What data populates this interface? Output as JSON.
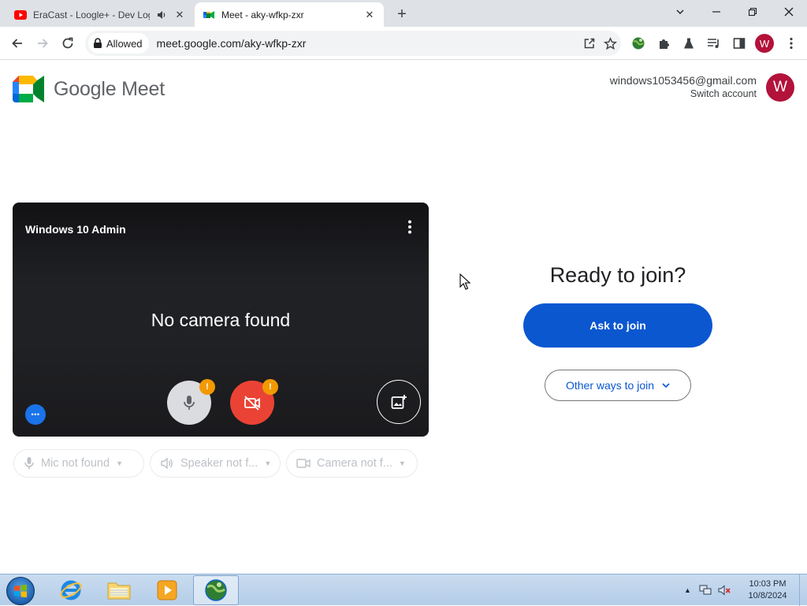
{
  "browser": {
    "tabs": [
      {
        "title": "EraCast - Loogle+ - Dev Log",
        "active": false
      },
      {
        "title": "Meet - aky-wfkp-zxr",
        "active": true
      }
    ],
    "new_tab_label": "+",
    "site_chip": "Allowed",
    "url": "meet.google.com/aky-wfkp-zxr",
    "profile_initial": "W"
  },
  "meet": {
    "brand": "Google Meet",
    "account_email": "windows1053456@gmail.com",
    "switch_account": "Switch account",
    "avatar_initial": "W",
    "participant_name": "Windows 10 Admin",
    "no_camera_text": "No camera found",
    "warn_glyph": "!",
    "more_dots": "•••",
    "devices": {
      "mic": "Mic not found",
      "speaker": "Speaker not f...",
      "camera": "Camera not f..."
    },
    "ready_heading": "Ready to join?",
    "ask_to_join": "Ask to join",
    "other_ways": "Other ways to join"
  },
  "taskbar": {
    "time": "10:03 PM",
    "date": "10/8/2024"
  },
  "colors": {
    "primary_blue": "#0b57d0",
    "cam_off_red": "#ea4335",
    "warning_orange": "#f29900",
    "avatar_maroon": "#b3123a"
  }
}
